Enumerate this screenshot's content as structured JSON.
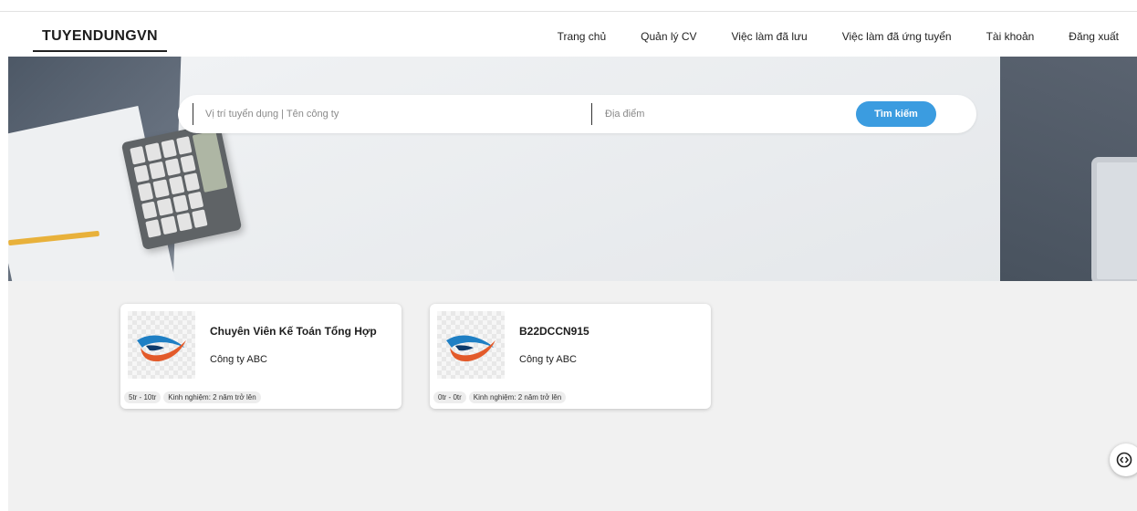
{
  "header": {
    "logo": "TUYENDUNGVN",
    "menu": [
      {
        "label": "Trang chủ"
      },
      {
        "label": "Quản lý CV"
      },
      {
        "label": "Việc làm đã lưu"
      },
      {
        "label": "Việc làm đã ứng tuyển"
      },
      {
        "label": "Tài khoản"
      },
      {
        "label": "Đăng xuất"
      }
    ]
  },
  "search": {
    "query_placeholder": "Vị trí tuyển dụng | Tên công ty",
    "location_placeholder": "Địa điểm",
    "button_label": "Tìm kiếm",
    "button_color": "#3b9ce0"
  },
  "jobs": [
    {
      "title": "Chuyên Viên Kế Toán Tổng Hợp",
      "company": "Công ty ABC",
      "salary": "5tr - 10tr",
      "experience": "Kinh nghiệm: 2 năm trở lên",
      "logo_icon": "company-swoosh-icon"
    },
    {
      "title": "B22DCCN915",
      "company": "Công ty ABC",
      "salary": "0tr - 0tr",
      "experience": "Kinh nghiệm: 2 năm trở lên",
      "logo_icon": "company-swoosh-icon"
    }
  ],
  "side_button": {
    "icon": "code-brackets-icon"
  }
}
